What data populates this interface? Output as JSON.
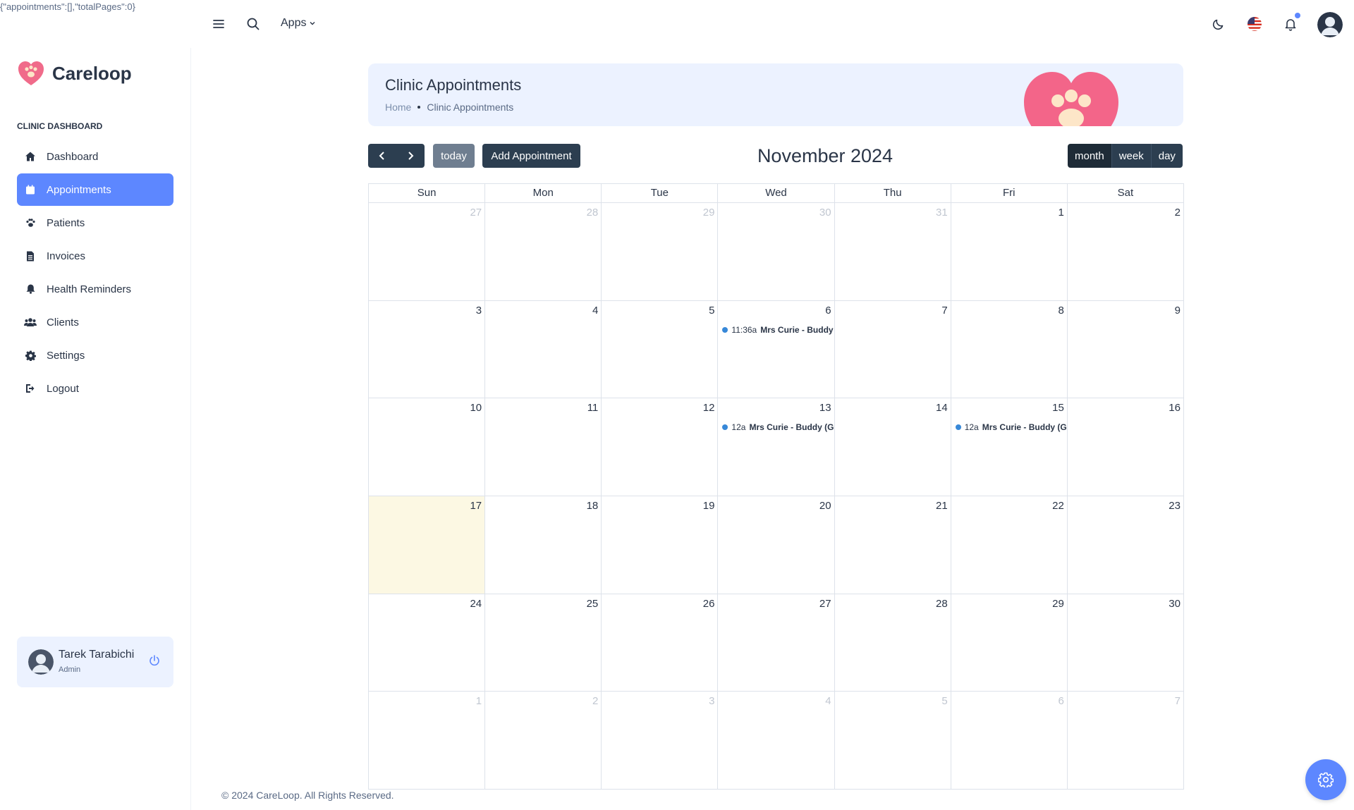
{
  "debug_text": "{\"appointments\":[],\"totalPages\":0}",
  "topbar": {
    "apps_label": "Apps"
  },
  "brand": {
    "name": "Careloop",
    "accent": "#5d87ff",
    "heart_color": "#f06b8a"
  },
  "sidebar": {
    "caption": "CLINIC DASHBOARD",
    "items": [
      {
        "label": "Dashboard",
        "icon": "home-icon"
      },
      {
        "label": "Appointments",
        "icon": "calendar-icon",
        "active": true
      },
      {
        "label": "Patients",
        "icon": "paw-icon"
      },
      {
        "label": "Invoices",
        "icon": "file-icon"
      },
      {
        "label": "Health Reminders",
        "icon": "bell-icon"
      },
      {
        "label": "Clients",
        "icon": "users-icon"
      },
      {
        "label": "Settings",
        "icon": "gear-icon"
      },
      {
        "label": "Logout",
        "icon": "logout-icon"
      }
    ]
  },
  "profile": {
    "name": "Tarek Tarabichi",
    "role": "Admin"
  },
  "banner": {
    "title": "Clinic Appointments",
    "breadcrumb_home": "Home",
    "breadcrumb_current": "Clinic Appointments"
  },
  "toolbar": {
    "today_label": "today",
    "add_label": "Add Appointment",
    "month_title": "November 2024",
    "views": [
      "month",
      "week",
      "day"
    ],
    "active_view": "month"
  },
  "calendar": {
    "weekdays": [
      "Sun",
      "Mon",
      "Tue",
      "Wed",
      "Thu",
      "Fri",
      "Sat"
    ],
    "weeks": [
      [
        {
          "d": "27",
          "other": true
        },
        {
          "d": "28",
          "other": true
        },
        {
          "d": "29",
          "other": true
        },
        {
          "d": "30",
          "other": true
        },
        {
          "d": "31",
          "other": true
        },
        {
          "d": "1"
        },
        {
          "d": "2"
        }
      ],
      [
        {
          "d": "3"
        },
        {
          "d": "4"
        },
        {
          "d": "5"
        },
        {
          "d": "6",
          "event": {
            "time": "11:36a",
            "title": "Mrs Curie - Buddy"
          }
        },
        {
          "d": "7"
        },
        {
          "d": "8"
        },
        {
          "d": "9"
        }
      ],
      [
        {
          "d": "10"
        },
        {
          "d": "11"
        },
        {
          "d": "12"
        },
        {
          "d": "13",
          "event": {
            "time": "12a",
            "title": "Mrs Curie - Buddy (Gr"
          }
        },
        {
          "d": "14"
        },
        {
          "d": "15",
          "event": {
            "time": "12a",
            "title": "Mrs Curie - Buddy (Gr"
          }
        },
        {
          "d": "16"
        }
      ],
      [
        {
          "d": "17",
          "today": true
        },
        {
          "d": "18"
        },
        {
          "d": "19"
        },
        {
          "d": "20"
        },
        {
          "d": "21"
        },
        {
          "d": "22"
        },
        {
          "d": "23"
        }
      ],
      [
        {
          "d": "24"
        },
        {
          "d": "25"
        },
        {
          "d": "26"
        },
        {
          "d": "27"
        },
        {
          "d": "28"
        },
        {
          "d": "29"
        },
        {
          "d": "30"
        }
      ],
      [
        {
          "d": "1",
          "other": true
        },
        {
          "d": "2",
          "other": true
        },
        {
          "d": "3",
          "other": true
        },
        {
          "d": "4",
          "other": true
        },
        {
          "d": "5",
          "other": true
        },
        {
          "d": "6",
          "other": true
        },
        {
          "d": "7",
          "other": true
        }
      ]
    ]
  },
  "footer": {
    "text": "© 2024 CareLoop. All Rights Reserved."
  }
}
